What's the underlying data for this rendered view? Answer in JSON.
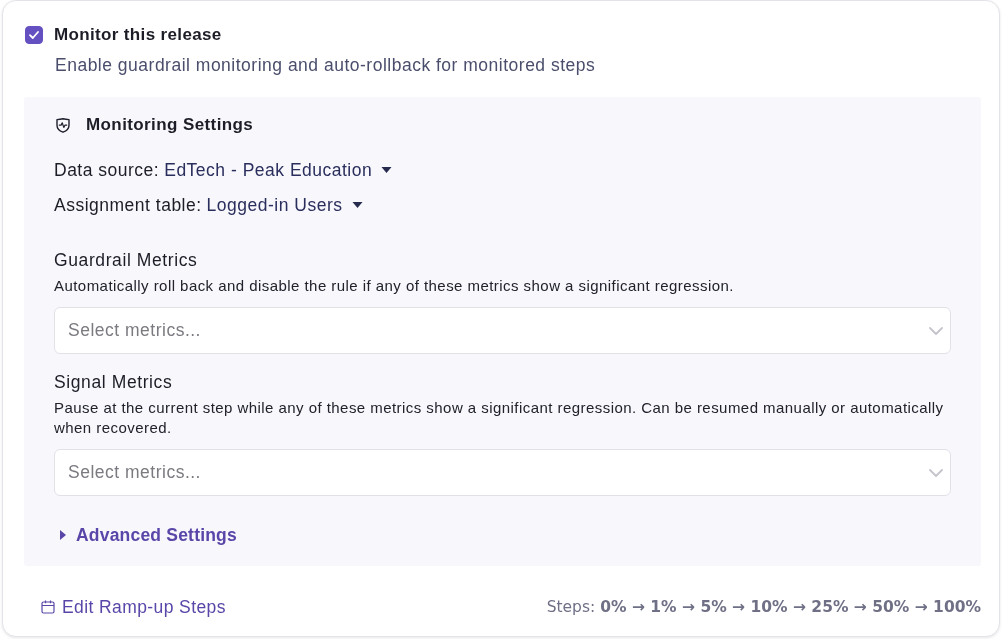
{
  "monitor": {
    "label": "Monitor this release",
    "checked": true,
    "description": "Enable guardrail monitoring and auto-rollback for monitored steps"
  },
  "settings": {
    "title": "Monitoring Settings",
    "selectors": [
      {
        "label": "Data source:",
        "value": "EdTech - Peak Education"
      },
      {
        "label": "Assignment table:",
        "value": "Logged-in Users"
      }
    ],
    "metric_groups": [
      {
        "title": "Guardrail Metrics",
        "description": "Automatically roll back and disable the rule if any of these metrics show a significant regression.",
        "placeholder": "Select metrics..."
      },
      {
        "title": "Signal Metrics",
        "description": "Pause at the current step while any of these metrics show a significant regression. Can be resumed manually or automatically when recovered.",
        "placeholder": "Select metrics..."
      }
    ],
    "advanced": {
      "label": "Advanced Settings",
      "expanded": false
    }
  },
  "footer": {
    "edit_link": "Edit Ramp-up Steps",
    "steps": "Steps: **0% → 1% → 5% → 10% → 25% → 50% → 100%**"
  }
}
